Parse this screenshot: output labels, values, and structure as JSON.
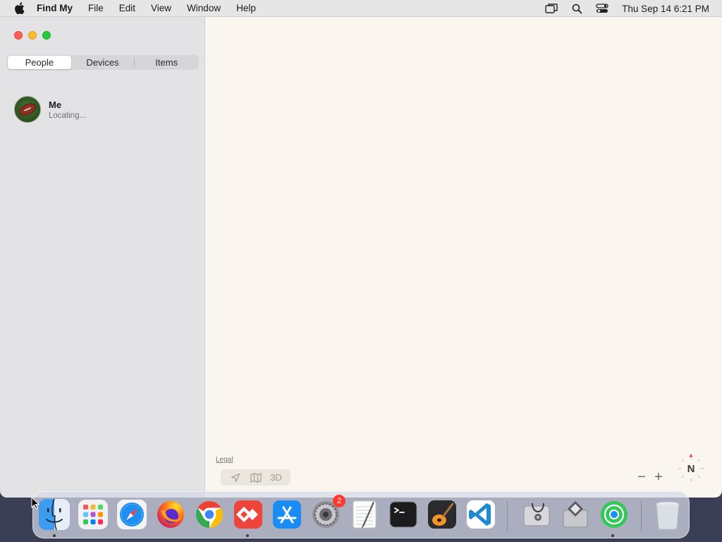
{
  "menubar": {
    "app_name": "Find My",
    "items": [
      "File",
      "Edit",
      "View",
      "Window",
      "Help"
    ],
    "clock": "Thu Sep 14  6:21 PM"
  },
  "sidebar": {
    "tabs": [
      {
        "label": "People",
        "active": true
      },
      {
        "label": "Devices",
        "active": false
      },
      {
        "label": "Items",
        "active": false
      }
    ],
    "people": [
      {
        "name": "Me",
        "status": "Locating..."
      }
    ]
  },
  "map": {
    "legal_label": "Legal",
    "view_3d_label": "3D",
    "zoom_out_label": "−",
    "zoom_in_label": "+",
    "compass_label": "N"
  },
  "dock": {
    "settings_badge": "2"
  },
  "colors": {
    "window_bg": "#faf6ef",
    "sidebar_bg": "#e3e3e5",
    "close": "#fe5f57",
    "minimize": "#febc2e",
    "zoom": "#28c840",
    "badge": "#ff3b30"
  }
}
